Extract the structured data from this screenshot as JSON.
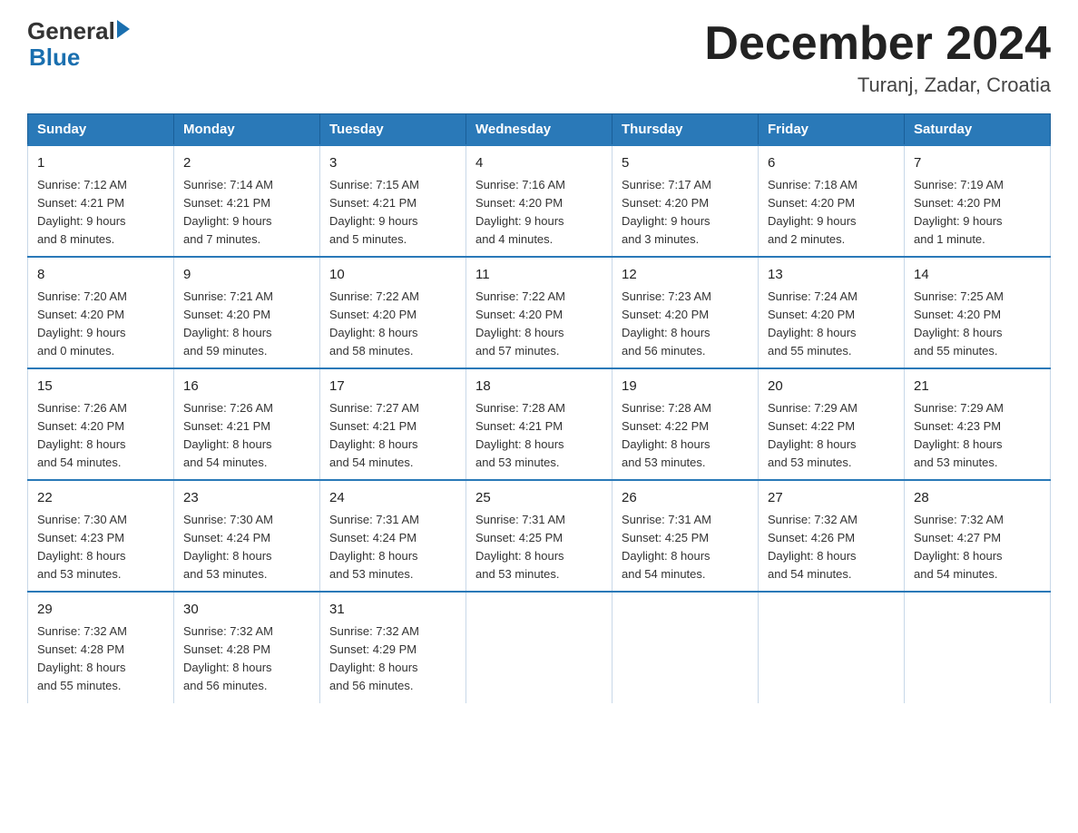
{
  "header": {
    "logo_general": "General",
    "logo_blue": "Blue",
    "month_title": "December 2024",
    "location": "Turanj, Zadar, Croatia"
  },
  "days_of_week": [
    "Sunday",
    "Monday",
    "Tuesday",
    "Wednesday",
    "Thursday",
    "Friday",
    "Saturday"
  ],
  "weeks": [
    [
      {
        "day": "1",
        "sunrise": "7:12 AM",
        "sunset": "4:21 PM",
        "daylight": "9 hours and 8 minutes."
      },
      {
        "day": "2",
        "sunrise": "7:14 AM",
        "sunset": "4:21 PM",
        "daylight": "9 hours and 7 minutes."
      },
      {
        "day": "3",
        "sunrise": "7:15 AM",
        "sunset": "4:21 PM",
        "daylight": "9 hours and 5 minutes."
      },
      {
        "day": "4",
        "sunrise": "7:16 AM",
        "sunset": "4:20 PM",
        "daylight": "9 hours and 4 minutes."
      },
      {
        "day": "5",
        "sunrise": "7:17 AM",
        "sunset": "4:20 PM",
        "daylight": "9 hours and 3 minutes."
      },
      {
        "day": "6",
        "sunrise": "7:18 AM",
        "sunset": "4:20 PM",
        "daylight": "9 hours and 2 minutes."
      },
      {
        "day": "7",
        "sunrise": "7:19 AM",
        "sunset": "4:20 PM",
        "daylight": "9 hours and 1 minute."
      }
    ],
    [
      {
        "day": "8",
        "sunrise": "7:20 AM",
        "sunset": "4:20 PM",
        "daylight": "9 hours and 0 minutes."
      },
      {
        "day": "9",
        "sunrise": "7:21 AM",
        "sunset": "4:20 PM",
        "daylight": "8 hours and 59 minutes."
      },
      {
        "day": "10",
        "sunrise": "7:22 AM",
        "sunset": "4:20 PM",
        "daylight": "8 hours and 58 minutes."
      },
      {
        "day": "11",
        "sunrise": "7:22 AM",
        "sunset": "4:20 PM",
        "daylight": "8 hours and 57 minutes."
      },
      {
        "day": "12",
        "sunrise": "7:23 AM",
        "sunset": "4:20 PM",
        "daylight": "8 hours and 56 minutes."
      },
      {
        "day": "13",
        "sunrise": "7:24 AM",
        "sunset": "4:20 PM",
        "daylight": "8 hours and 55 minutes."
      },
      {
        "day": "14",
        "sunrise": "7:25 AM",
        "sunset": "4:20 PM",
        "daylight": "8 hours and 55 minutes."
      }
    ],
    [
      {
        "day": "15",
        "sunrise": "7:26 AM",
        "sunset": "4:20 PM",
        "daylight": "8 hours and 54 minutes."
      },
      {
        "day": "16",
        "sunrise": "7:26 AM",
        "sunset": "4:21 PM",
        "daylight": "8 hours and 54 minutes."
      },
      {
        "day": "17",
        "sunrise": "7:27 AM",
        "sunset": "4:21 PM",
        "daylight": "8 hours and 54 minutes."
      },
      {
        "day": "18",
        "sunrise": "7:28 AM",
        "sunset": "4:21 PM",
        "daylight": "8 hours and 53 minutes."
      },
      {
        "day": "19",
        "sunrise": "7:28 AM",
        "sunset": "4:22 PM",
        "daylight": "8 hours and 53 minutes."
      },
      {
        "day": "20",
        "sunrise": "7:29 AM",
        "sunset": "4:22 PM",
        "daylight": "8 hours and 53 minutes."
      },
      {
        "day": "21",
        "sunrise": "7:29 AM",
        "sunset": "4:23 PM",
        "daylight": "8 hours and 53 minutes."
      }
    ],
    [
      {
        "day": "22",
        "sunrise": "7:30 AM",
        "sunset": "4:23 PM",
        "daylight": "8 hours and 53 minutes."
      },
      {
        "day": "23",
        "sunrise": "7:30 AM",
        "sunset": "4:24 PM",
        "daylight": "8 hours and 53 minutes."
      },
      {
        "day": "24",
        "sunrise": "7:31 AM",
        "sunset": "4:24 PM",
        "daylight": "8 hours and 53 minutes."
      },
      {
        "day": "25",
        "sunrise": "7:31 AM",
        "sunset": "4:25 PM",
        "daylight": "8 hours and 53 minutes."
      },
      {
        "day": "26",
        "sunrise": "7:31 AM",
        "sunset": "4:25 PM",
        "daylight": "8 hours and 54 minutes."
      },
      {
        "day": "27",
        "sunrise": "7:32 AM",
        "sunset": "4:26 PM",
        "daylight": "8 hours and 54 minutes."
      },
      {
        "day": "28",
        "sunrise": "7:32 AM",
        "sunset": "4:27 PM",
        "daylight": "8 hours and 54 minutes."
      }
    ],
    [
      {
        "day": "29",
        "sunrise": "7:32 AM",
        "sunset": "4:28 PM",
        "daylight": "8 hours and 55 minutes."
      },
      {
        "day": "30",
        "sunrise": "7:32 AM",
        "sunset": "4:28 PM",
        "daylight": "8 hours and 56 minutes."
      },
      {
        "day": "31",
        "sunrise": "7:32 AM",
        "sunset": "4:29 PM",
        "daylight": "8 hours and 56 minutes."
      },
      null,
      null,
      null,
      null
    ]
  ]
}
